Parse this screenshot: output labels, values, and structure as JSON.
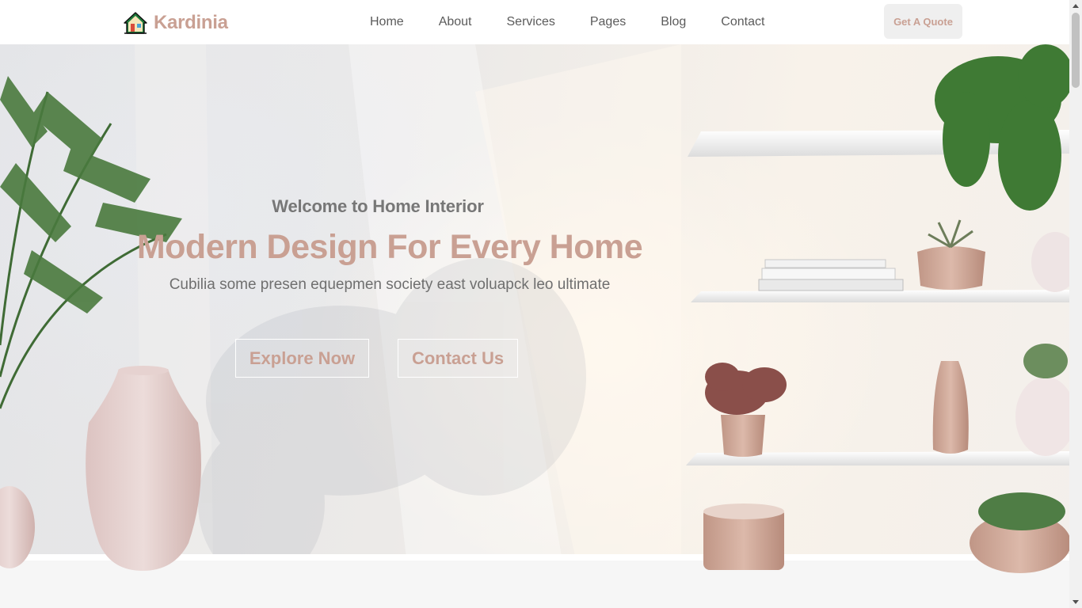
{
  "header": {
    "brand": "Kardinia",
    "brand_icon": "house-icon",
    "nav": [
      "Home",
      "About",
      "Services",
      "Pages",
      "Blog",
      "Contact"
    ],
    "cta_label": "Get A Quote"
  },
  "hero": {
    "welcome": "Welcome to Home Interior",
    "title": "Modern Design For Every Home",
    "subtitle": "Cubilia some presen equepmen society east voluapck leo ultimate",
    "primary_button": "Explore Now",
    "secondary_button": "Contact Us"
  },
  "colors": {
    "accent": "#c9a093",
    "nav_text": "#5b5b5b",
    "cta_bg": "#efefef"
  }
}
